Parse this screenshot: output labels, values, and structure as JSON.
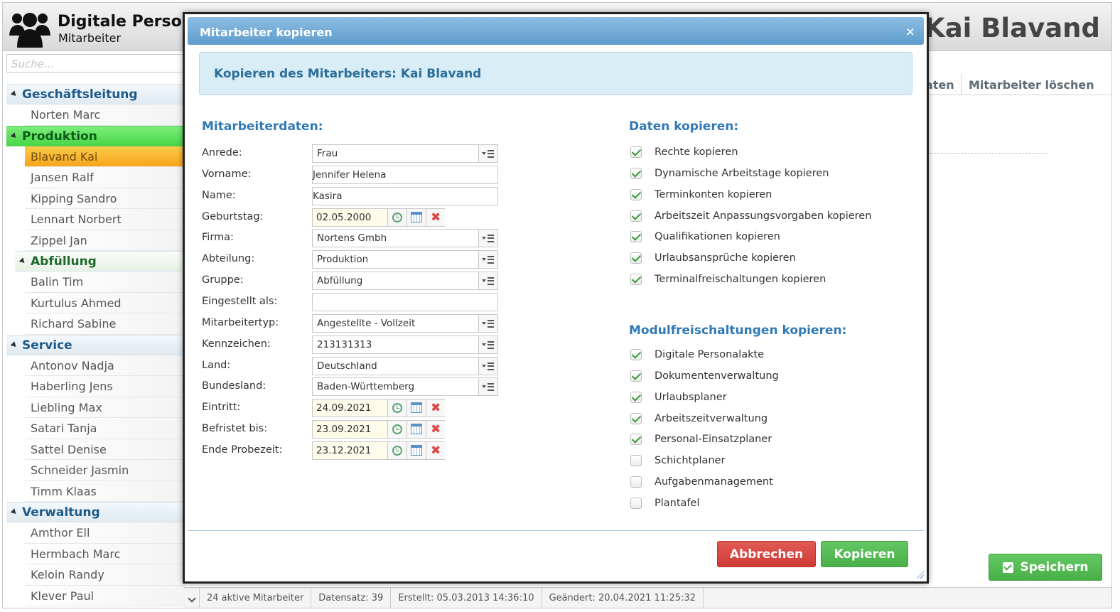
{
  "app": {
    "title": "Digitale Person",
    "subtitle": "Mitarbeiter",
    "employee_name": "Kai Blavand"
  },
  "search": {
    "placeholder": "Suche..."
  },
  "tree": [
    {
      "group": "Geschäftsleitung",
      "style": "blue",
      "items": [
        "Norten Marc"
      ]
    },
    {
      "group": "Produktion",
      "style": "green",
      "items": [
        "Blavand Kai",
        "Jansen Ralf",
        "Kipping Sandro",
        "Lennart Norbert",
        "Zippel Jan"
      ],
      "selected": "Blavand Kai"
    },
    {
      "group": "Abfüllung",
      "style": "sub",
      "items": [
        "Balin Tim",
        "Kurtulus Ahmed",
        "Richard Sabine"
      ]
    },
    {
      "group": "Service",
      "style": "blue",
      "items": [
        "Antonov Nadja",
        "Haberling Jens",
        "Liebling Max",
        "Satari Tanja",
        "Sattel Denise",
        "Schneider Jasmin",
        "Timm Klaas"
      ]
    },
    {
      "group": "Verwaltung",
      "style": "blue",
      "items": [
        "Amthor Ell",
        "Hermbach Marc",
        "Keloin Randy",
        "Klever Paul"
      ]
    }
  ],
  "tabs": {
    "partial": "aten",
    "delete": "Mitarbeiter löschen"
  },
  "save_button": "Speichern",
  "status": {
    "active": "24 aktive Mitarbeiter",
    "record": "Datensatz: 39",
    "created": "Erstellt: 05.03.2013 14:36:10",
    "changed": "Geändert: 20.04.2021 11:25:32"
  },
  "dialog": {
    "title": "Mitarbeiter kopieren",
    "close": "×",
    "info": "Kopieren des Mitarbeiters: Kai Blavand",
    "left_title": "Mitarbeiterdaten:",
    "fields": [
      {
        "label": "Anrede:",
        "value": "Frau",
        "type": "select"
      },
      {
        "label": "Vorname:",
        "value": "Jennifer Helena",
        "type": "text"
      },
      {
        "label": "Name:",
        "value": "Kasira",
        "type": "text"
      },
      {
        "label": "Geburtstag:",
        "value": "02.05.2000",
        "type": "date"
      },
      {
        "label": "Firma:",
        "value": "Nortens Gmbh",
        "type": "select"
      },
      {
        "label": "Abteilung:",
        "value": "Produktion",
        "type": "select"
      },
      {
        "label": "Gruppe:",
        "value": "Abfüllung",
        "type": "select"
      },
      {
        "label": "Eingestellt als:",
        "value": "",
        "type": "text"
      },
      {
        "label": "Mitarbeitertyp:",
        "value": "Angestellte - Vollzeit",
        "type": "select"
      },
      {
        "label": "Kennzeichen:",
        "value": "213131313",
        "type": "select"
      },
      {
        "label": "Land:",
        "value": "Deutschland",
        "type": "select"
      },
      {
        "label": "Bundesland:",
        "value": "Baden-Württemberg",
        "type": "select"
      },
      {
        "label": "Eintritt:",
        "value": "24.09.2021",
        "type": "date"
      },
      {
        "label": "Befristet bis:",
        "value": "23.09.2021",
        "type": "date"
      },
      {
        "label": "Ende Probezeit:",
        "value": "23.12.2021",
        "type": "date"
      }
    ],
    "copy_title": "Daten kopieren:",
    "copy_options": [
      {
        "label": "Rechte kopieren",
        "checked": true
      },
      {
        "label": "Dynamische Arbeitstage kopieren",
        "checked": true
      },
      {
        "label": "Terminkonten kopieren",
        "checked": true
      },
      {
        "label": "Arbeitszeit Anpassungsvorgaben kopieren",
        "checked": true
      },
      {
        "label": "Qualifikationen kopieren",
        "checked": true
      },
      {
        "label": "Urlaubsansprüche kopieren",
        "checked": true
      },
      {
        "label": "Terminalfreischaltungen kopieren",
        "checked": true
      }
    ],
    "module_title": "Modulfreischaltungen kopieren:",
    "module_options": [
      {
        "label": "Digitale Personalakte",
        "checked": true
      },
      {
        "label": "Dokumentenverwaltung",
        "checked": true
      },
      {
        "label": "Urlaubsplaner",
        "checked": true
      },
      {
        "label": "Arbeitszeitverwaltung",
        "checked": true
      },
      {
        "label": "Personal-Einsatzplaner",
        "checked": true
      },
      {
        "label": "Schichtplaner",
        "checked": false
      },
      {
        "label": "Aufgabenmanagement",
        "checked": false
      },
      {
        "label": "Plantafel",
        "checked": false
      }
    ],
    "cancel": "Abbrechen",
    "copy": "Kopieren"
  }
}
